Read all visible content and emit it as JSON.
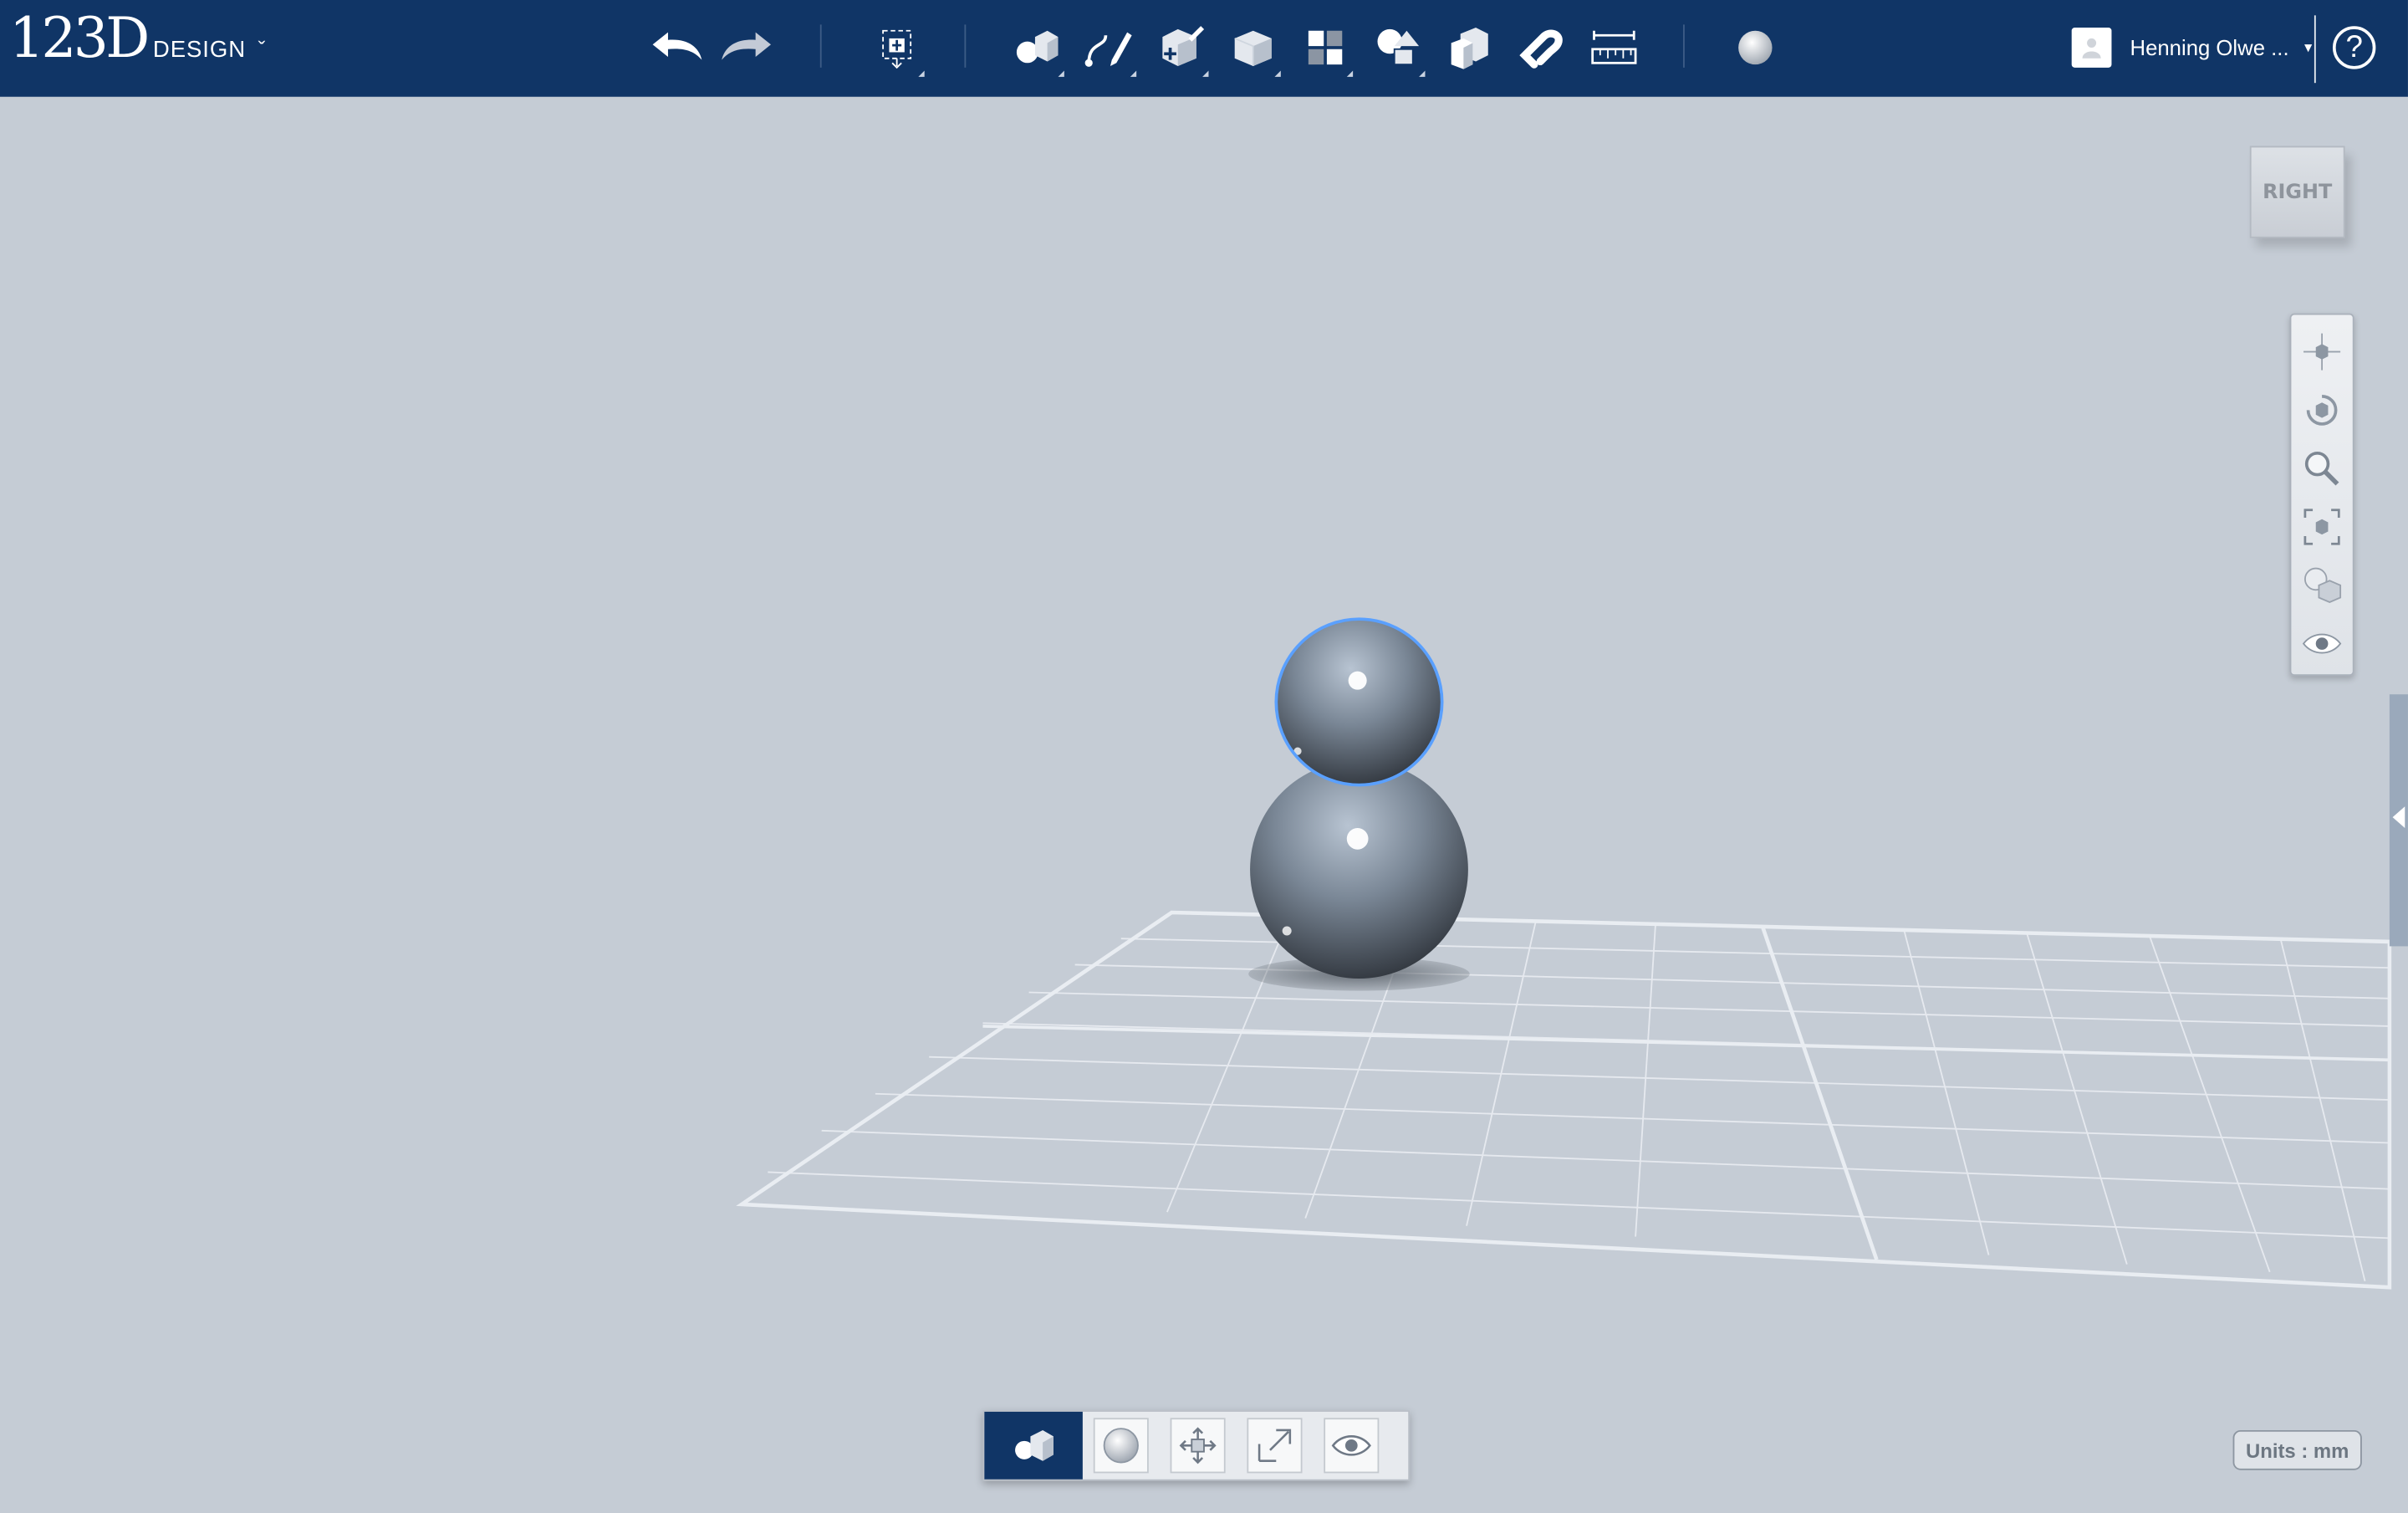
{
  "app": {
    "logo_number": "123D",
    "logo_word": "DESIGN",
    "logo_caret": "ˇ"
  },
  "toolbar": {
    "tools": [
      {
        "name": "undo-icon"
      },
      {
        "name": "redo-icon"
      },
      {
        "name": "transform-icon"
      },
      {
        "name": "primitives-icon"
      },
      {
        "name": "sketch-icon"
      },
      {
        "name": "construct-icon"
      },
      {
        "name": "modify-icon"
      },
      {
        "name": "pattern-icon"
      },
      {
        "name": "grouping-icon"
      },
      {
        "name": "combine-icon"
      },
      {
        "name": "snap-icon"
      },
      {
        "name": "measure-icon"
      },
      {
        "name": "material-icon"
      }
    ]
  },
  "user": {
    "name": "Henning Olwe ...",
    "caret": "▾"
  },
  "help": {
    "label": "?"
  },
  "viewcube": {
    "face": "RIGHT"
  },
  "navigation": {
    "buttons": [
      "pan-icon",
      "orbit-icon",
      "zoom-icon",
      "fit-icon",
      "view-mode-icon",
      "visibility-icon"
    ]
  },
  "bottom_toolbar": {
    "buttons": [
      "select-solid-icon",
      "select-sphere-icon",
      "move-icon",
      "scale-icon",
      "eye-icon"
    ]
  },
  "status": {
    "units": "Units : mm"
  },
  "colors": {
    "toolbar_bg": "#103566",
    "canvas_bg": "#c5ccd5",
    "selection_outline": "#5aa0ff"
  }
}
